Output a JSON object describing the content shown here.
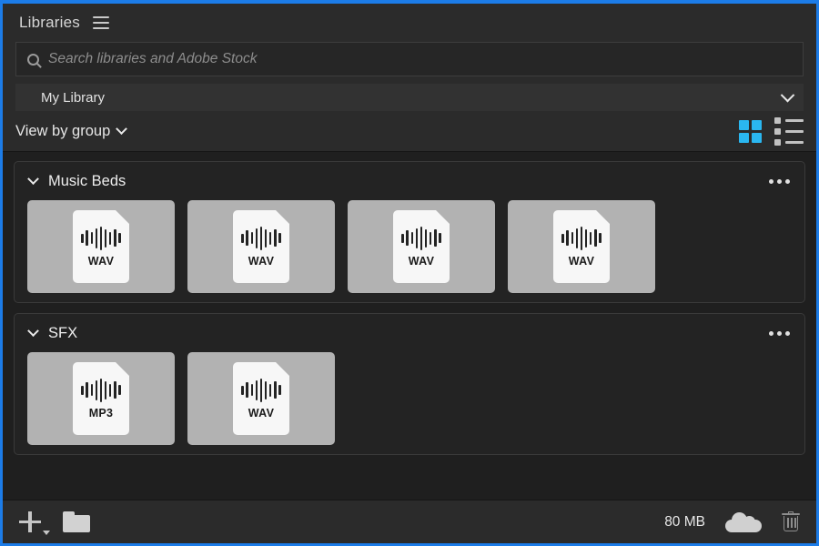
{
  "panel": {
    "title": "Libraries",
    "menu_icon": "hamburger-icon",
    "accent_color": "#1c7ce8"
  },
  "search": {
    "placeholder": "Search libraries and Adobe Stock",
    "value": "",
    "icon": "search-icon"
  },
  "library_select": {
    "selected": "My Library",
    "icon": "chevron-down-icon"
  },
  "view_toolbar": {
    "view_by_label": "View by group",
    "view_by_icon": "chevron-down-icon",
    "grid_view": {
      "icon": "grid-view-icon",
      "active": true,
      "active_color": "#2ab7f0"
    },
    "list_view": {
      "icon": "list-view-icon",
      "active": false,
      "inactive_color": "#c2c2c2"
    }
  },
  "groups": [
    {
      "name": "Music Beds",
      "expanded": true,
      "collapse_icon": "chevron-down-icon",
      "overflow_icon": "more-options-icon",
      "assets": [
        {
          "format": "WAV",
          "icon": "audio-waveform-icon"
        },
        {
          "format": "WAV",
          "icon": "audio-waveform-icon"
        },
        {
          "format": "WAV",
          "icon": "audio-waveform-icon"
        },
        {
          "format": "WAV",
          "icon": "audio-waveform-icon"
        }
      ]
    },
    {
      "name": "SFX",
      "expanded": true,
      "collapse_icon": "chevron-down-icon",
      "overflow_icon": "more-options-icon",
      "assets": [
        {
          "format": "MP3",
          "icon": "audio-waveform-icon"
        },
        {
          "format": "WAV",
          "icon": "audio-waveform-icon"
        }
      ]
    }
  ],
  "footer": {
    "add_label": "",
    "add_icon": "plus-icon",
    "add_caret_icon": "caret-down-icon",
    "new_group_icon": "folder-icon",
    "storage_size": "80 MB",
    "sync_icon": "cloud-icon",
    "delete_icon": "trash-icon"
  },
  "waveform_bars": [
    10,
    17,
    13,
    22,
    26,
    20,
    14,
    19,
    11
  ]
}
